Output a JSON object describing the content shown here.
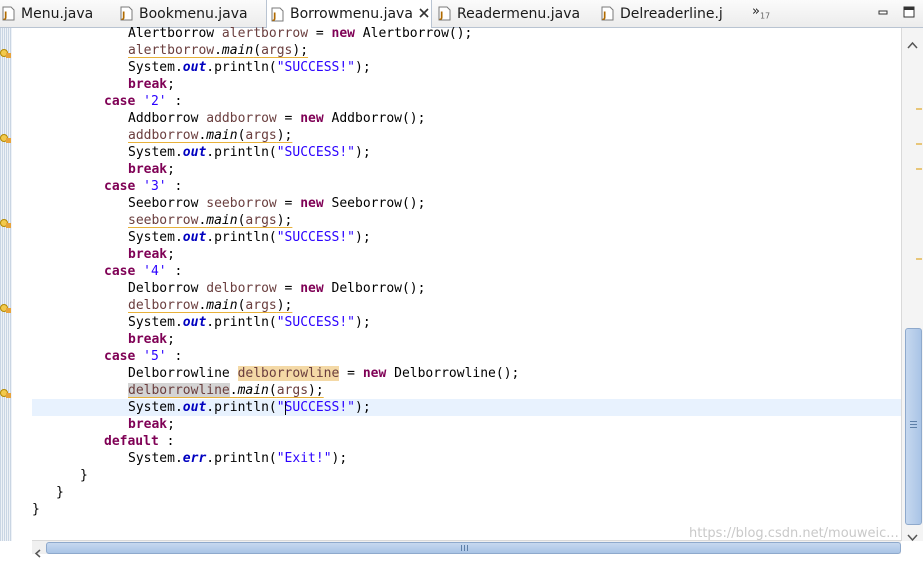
{
  "tabs": [
    {
      "label": "Menu.java",
      "active": false
    },
    {
      "label": "Bookmenu.java",
      "active": false
    },
    {
      "label": "Borrowmenu.java",
      "active": true
    },
    {
      "label": "Readermenu.java",
      "active": false
    },
    {
      "label": "Delreaderline.j",
      "active": false
    }
  ],
  "tab_overflow": {
    "symbol": "»",
    "count": "17"
  },
  "code": {
    "l0": {
      "a": "Alertborrow ",
      "b": "alertborrow",
      "c": " = ",
      "d": "new",
      "e": " Alertborrow();"
    },
    "l1": {
      "a": "alertborrow",
      "b": ".",
      "c": "main",
      "d": "(",
      "e": "args",
      "f": ");"
    },
    "l2": {
      "a": "System.",
      "b": "out",
      "c": ".println(",
      "d": "\"SUCCESS!\"",
      "e": ");"
    },
    "l3": {
      "a": "break",
      "b": ";"
    },
    "l4": {
      "a": "case",
      "b": " ",
      "c": "'2'",
      "d": " :"
    },
    "l5": {
      "a": "Addborrow ",
      "b": "addborrow",
      "c": " = ",
      "d": "new",
      "e": " Addborrow();"
    },
    "l6": {
      "a": "addborrow",
      "b": ".",
      "c": "main",
      "d": "(",
      "e": "args",
      "f": ");"
    },
    "l7": {
      "a": "System.",
      "b": "out",
      "c": ".println(",
      "d": "\"SUCCESS!\"",
      "e": ");"
    },
    "l8": {
      "a": "break",
      "b": ";"
    },
    "l9": {
      "a": "case",
      "b": " ",
      "c": "'3'",
      "d": " :"
    },
    "l10": {
      "a": "Seeborrow ",
      "b": "seeborrow",
      "c": " = ",
      "d": "new",
      "e": " Seeborrow();"
    },
    "l11": {
      "a": "seeborrow",
      "b": ".",
      "c": "main",
      "d": "(",
      "e": "args",
      "f": ");"
    },
    "l12": {
      "a": "System.",
      "b": "out",
      "c": ".println(",
      "d": "\"SUCCESS!\"",
      "e": ");"
    },
    "l13": {
      "a": "break",
      "b": ";"
    },
    "l14": {
      "a": "case",
      "b": " ",
      "c": "'4'",
      "d": " :"
    },
    "l15": {
      "a": "Delborrow ",
      "b": "delborrow",
      "c": " = ",
      "d": "new",
      "e": " Delborrow();"
    },
    "l16": {
      "a": "delborrow",
      "b": ".",
      "c": "main",
      "d": "(",
      "e": "args",
      "f": ");"
    },
    "l17": {
      "a": "System.",
      "b": "out",
      "c": ".println(",
      "d": "\"SUCCESS!\"",
      "e": ");"
    },
    "l18": {
      "a": "break",
      "b": ";"
    },
    "l19": {
      "a": "case",
      "b": " ",
      "c": "'5'",
      "d": " :"
    },
    "l20": {
      "a": "Delborrowline ",
      "b": "delborrowline",
      "c": " = ",
      "d": "new",
      "e": " Delborrowline();"
    },
    "l21": {
      "a": "delborrowline",
      "b": ".",
      "c": "main",
      "d": "(",
      "e": "args",
      "f": ");"
    },
    "l22": {
      "a": "System.",
      "b": "out",
      "c": ".println(",
      "d1": "\"",
      "d2": "SUCCESS!\"",
      "e": ");"
    },
    "l23": {
      "a": "break",
      "b": ";"
    },
    "l24": {
      "a": "default",
      "b": " :"
    },
    "l25": {
      "a": "System.",
      "b": "err",
      "c": ".println(",
      "d": "\"Exit!\"",
      "e": ");"
    },
    "l26": {
      "a": "}"
    },
    "l27": {
      "a": "}"
    },
    "l28": {
      "a": "}"
    }
  },
  "watermark": "https://blog.csdn.net/mouweic...",
  "colors": {
    "keyword": "#7f0055",
    "string": "#2a00ff",
    "field": "#0000c0",
    "variable": "#6a3e3e",
    "current_line": "#e8f2fe"
  },
  "icons": {
    "tab": "java-file-icon",
    "gutter": "warning-marker-icon"
  }
}
